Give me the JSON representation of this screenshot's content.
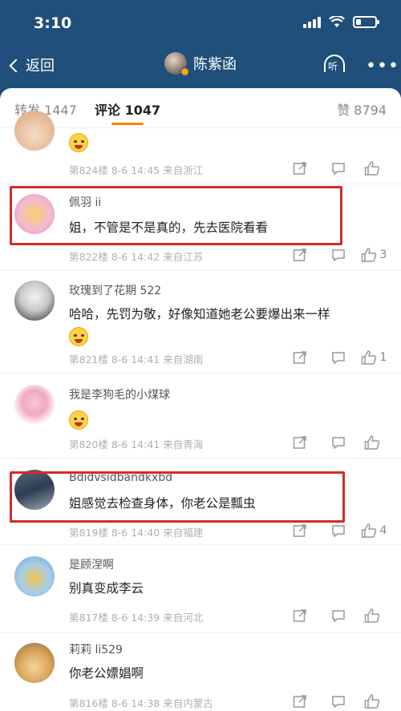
{
  "status": {
    "time": "3:10"
  },
  "nav": {
    "back_label": "返回",
    "title": "陈紫函",
    "listen_label": "听",
    "more_label": "•••"
  },
  "tabs": {
    "repost": "转发 1447",
    "comment": "评论 1047",
    "like": "赞 8794"
  },
  "comments": [
    {
      "name": "",
      "text": "",
      "meta": "第824楼  8-6 14:45  来自浙江",
      "likes": ""
    },
    {
      "name": "佩羽 ii",
      "text": "姐，不管是不是真的，先去医院看看",
      "meta": "第822楼  8-6 14:42  来自江苏",
      "likes": "3"
    },
    {
      "name": "玫瑰到了花期 522",
      "text": "哈哈，先罚为敬，好像知道她老公要爆出来一样",
      "meta": "第821楼  8-6 14:41  来自湖南",
      "likes": "1"
    },
    {
      "name": "我是李狗毛的小煤球",
      "text": "",
      "meta": "第820楼  8-6 14:41  来自青海",
      "likes": ""
    },
    {
      "name": "Bdidvsidbandkxbd",
      "text": "姐感觉去检查身体，你老公是瓢虫",
      "meta": "第819楼  8-6 14:40  来自福建",
      "likes": "4"
    },
    {
      "name": "是顾涅啊",
      "text": "别真变成李云",
      "meta": "第817楼  8-6 14:39  来自河北",
      "likes": ""
    },
    {
      "name": "莉莉 li529",
      "text": "你老公嫖娼啊",
      "meta": "第816楼  8-6 14:38  来自内蒙古",
      "likes": ""
    }
  ],
  "colors": {
    "accent": "#ff8200",
    "highlight": "#d42a2a",
    "header_bg": "#1f4f7a"
  }
}
